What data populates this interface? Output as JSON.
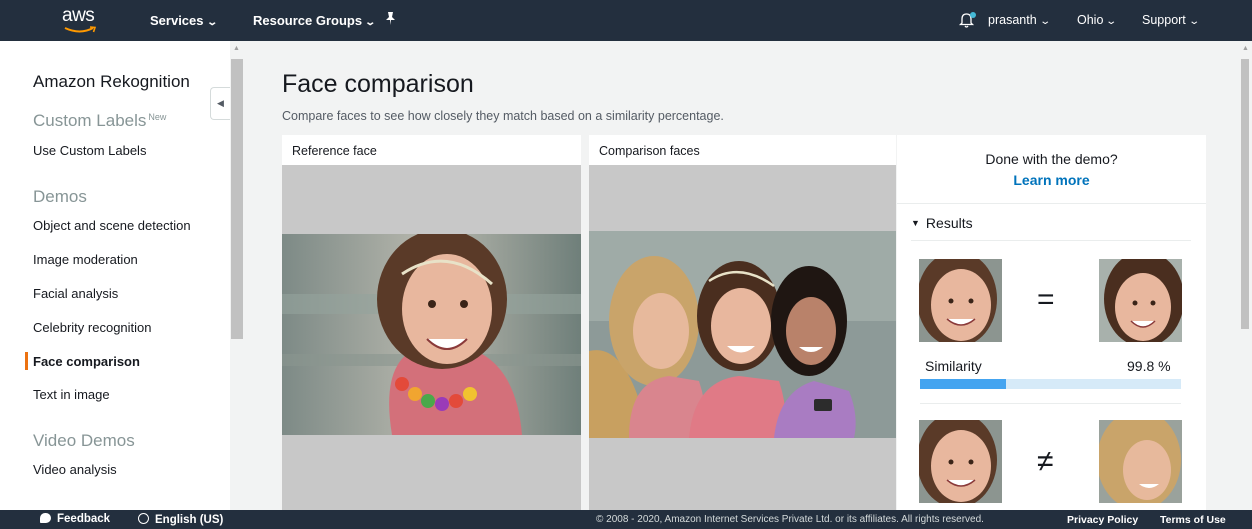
{
  "topnav": {
    "logo_text": "aws",
    "services": "Services",
    "resource_groups": "Resource Groups",
    "user": "prasanth",
    "region": "Ohio",
    "support": "Support"
  },
  "sidebar": {
    "title": "Amazon Rekognition",
    "custom_labels_heading": "Custom Labels",
    "new_badge": "New",
    "use_custom_labels": "Use Custom Labels",
    "demos_heading": "Demos",
    "items": [
      {
        "label": "Object and scene detection"
      },
      {
        "label": "Image moderation"
      },
      {
        "label": "Facial analysis"
      },
      {
        "label": "Celebrity recognition"
      },
      {
        "label": "Face comparison"
      },
      {
        "label": "Text in image"
      }
    ],
    "video_heading": "Video Demos",
    "video_item": "Video analysis"
  },
  "main": {
    "title": "Face comparison",
    "description": "Compare faces to see how closely they match based on a similarity percentage.",
    "reference_label": "Reference face",
    "comparison_label": "Comparison faces"
  },
  "results": {
    "done_text": "Done with the demo?",
    "learn_more": "Learn more",
    "toggle_label": "Results",
    "match_symbol": "=",
    "nomatch_symbol": "≠",
    "similarity_label": "Similarity",
    "similarity_value": "99.8 %",
    "similarity_bar_fraction": 0.33
  },
  "footer": {
    "feedback": "Feedback",
    "language": "English (US)",
    "copyright": "© 2008 - 2020, Amazon Internet Services Private Ltd. or its affiliates. All rights reserved.",
    "privacy": "Privacy Policy",
    "terms": "Terms of Use"
  },
  "colors": {
    "nav_bg": "#232f3e",
    "accent_orange": "#ec7211",
    "link_blue": "#0073bb",
    "bar_fill": "#44a4f0"
  }
}
